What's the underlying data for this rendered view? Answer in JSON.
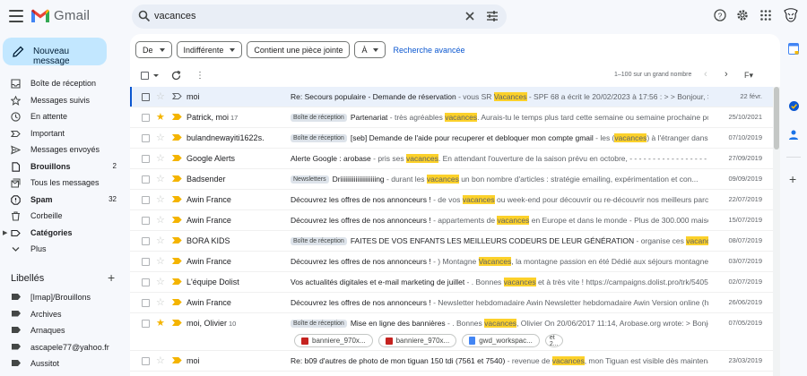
{
  "app": {
    "name": "Gmail",
    "colors": {
      "accent": "#0b57d0",
      "compose": "#c2e7ff",
      "highlight": "#fcd12a",
      "star": "#f4b400",
      "important": "#f4b400"
    }
  },
  "search": {
    "query": "vacances",
    "icons": [
      "search-icon",
      "clear-icon",
      "filter-options-icon"
    ]
  },
  "header_icons": [
    "help-icon",
    "gear-icon",
    "apps-grid-icon",
    "account-avatar"
  ],
  "compose": {
    "label": "Nouveau message"
  },
  "nav": [
    {
      "label": "Boîte de réception",
      "icon": "inbox-icon",
      "count": ""
    },
    {
      "label": "Messages suivis",
      "icon": "star-icon",
      "count": ""
    },
    {
      "label": "En attente",
      "icon": "clock-icon",
      "count": ""
    },
    {
      "label": "Important",
      "icon": "important-icon",
      "count": ""
    },
    {
      "label": "Messages envoyés",
      "icon": "send-icon",
      "count": ""
    },
    {
      "label": "Brouillons",
      "icon": "draft-icon",
      "count": "2",
      "bold": true
    },
    {
      "label": "Tous les messages",
      "icon": "all-mail-icon",
      "count": ""
    },
    {
      "label": "Spam",
      "icon": "spam-icon",
      "count": "32",
      "bold": true
    },
    {
      "label": "Corbeille",
      "icon": "trash-icon",
      "count": ""
    },
    {
      "label": "Catégories",
      "icon": "category-icon",
      "count": "",
      "bold": true
    },
    {
      "label": "Plus",
      "icon": "chevron-down-icon",
      "count": ""
    }
  ],
  "labels": {
    "title": "Libellés",
    "items": [
      "[Imap]/Brouillons",
      "Archives",
      "Arnaques",
      "ascapele77@yahoo.fr",
      "Aussitot"
    ]
  },
  "filters": {
    "from": "De",
    "date": "Indifférente",
    "has_attachment": "Contient une pièce jointe",
    "to": "À",
    "advanced": "Recherche avancée"
  },
  "pager": {
    "text": "1–100 sur un grand nombre"
  },
  "emails": [
    {
      "from": "moi",
      "count": "",
      "badge": "",
      "subject": "Re: Secours populaire - Demande de réservation",
      "snippet_pre": " - vous SR ",
      "highlight": "Vacances",
      "snippet_post": " - SPF 68 a écrit le 20/02/2023 à 17:56 : > > Bonjour, > > Je...",
      "date": "22 févr.",
      "starred": false,
      "important": false,
      "selected": true
    },
    {
      "from": "Patrick, moi",
      "count": "17",
      "badge": "Boîte de réception",
      "subject": "Partenariat",
      "snippet_pre": " - très agréables ",
      "highlight": "vacances",
      "snippet_post": ". Aurais-tu le temps plus tard cette semaine ou semaine prochaine pour...",
      "date": "25/10/2021",
      "starred": true,
      "important": true
    },
    {
      "from": "bulandnewayiti1622s.",
      "count": "",
      "badge": "Boîte de réception",
      "subject": "[seb] Demande de l'aide pour recuperer et debloquer mon compte gmail",
      "snippet_pre": " - les (",
      "highlight": "vacances",
      "snippet_post": ") à l'étranger dans ...",
      "date": "07/10/2019",
      "starred": false,
      "important": true
    },
    {
      "from": "Google Alerts",
      "count": "",
      "badge": "",
      "subject": "Alerte Google : arobase",
      "snippet_pre": " - pris ses ",
      "highlight": "vacances",
      "snippet_post": ". En attendant l'ouverture de la saison prévu en octobre, - - - - - - - - - - - - - - - - - -",
      "date": "27/09/2019",
      "starred": false,
      "important": true
    },
    {
      "from": "Badsender",
      "count": "",
      "badge": "Newsletters",
      "subject": "Driiiiiiiiiiiiiiiiiiiiing",
      "snippet_pre": " - durant les ",
      "highlight": "vacances",
      "snippet_post": " un bon nombre d'articles : stratégie emailing, expérimentation et con...",
      "date": "09/09/2019",
      "starred": false,
      "important": true
    },
    {
      "from": "Awin France",
      "count": "",
      "badge": "",
      "subject": "Découvrez les offres de nos annonceurs !",
      "snippet_pre": " - de vos ",
      "highlight": "vacances",
      "snippet_post": " ou week-end pour découvrir ou re-découvrir nos meilleurs parc...",
      "date": "22/07/2019",
      "starred": false,
      "important": true
    },
    {
      "from": "Awin France",
      "count": "",
      "badge": "",
      "subject": "Découvrez les offres de nos annonceurs !",
      "snippet_pre": " - appartements de ",
      "highlight": "vacances",
      "snippet_post": " en Europe et dans le monde - Plus de 300.000 maiso...",
      "date": "15/07/2019",
      "starred": false,
      "important": true
    },
    {
      "from": "BORA KIDS",
      "count": "",
      "badge": "Boîte de réception",
      "subject": "FAITES DE VOS ENFANTS LES MEILLEURS CODEURS DE LEUR GÉNÉRATION",
      "snippet_pre": " - organise ces ",
      "highlight": "vacances",
      "snippet_post": " des s...",
      "date": "08/07/2019",
      "starred": false,
      "important": true
    },
    {
      "from": "Awin France",
      "count": "",
      "badge": "",
      "subject": "Découvrez les offres de nos annonceurs !",
      "snippet_pre": " - ) Montagne ",
      "highlight": "Vacances",
      "snippet_post": ", la montagne passion en été Dédié aux séjours montagne e...",
      "date": "03/07/2019",
      "starred": false,
      "important": true
    },
    {
      "from": "L'équipe Dolist",
      "count": "",
      "badge": "",
      "subject": "Vos actualités digitales et e-mail marketing de juillet",
      "snippet_pre": " - . Bonnes ",
      "highlight": "vacances",
      "snippet_post": " et à très vite ! https://campaigns.dolist.pro/trk/5405...",
      "date": "02/07/2019",
      "starred": false,
      "important": true
    },
    {
      "from": "Awin France",
      "count": "",
      "badge": "",
      "subject": "Découvrez les offres de nos annonceurs !",
      "snippet_pre": " - Newsletter hebdomadaire Awin Newsletter hebdomadaire Awin Version online (htt...",
      "highlight": "",
      "snippet_post": "",
      "date": "26/06/2019",
      "starred": false,
      "important": true
    },
    {
      "from": "moi, Olivier",
      "count": "10",
      "badge": "Boîte de réception",
      "subject": "Mise en ligne des bannières",
      "snippet_pre": " - . Bonnes ",
      "highlight": "vacances",
      "snippet_post": ", Olivier On 20/06/2017 11:14, Arobase.org wrote: > Bonjour...",
      "date": "07/05/2019",
      "starred": true,
      "important": true,
      "attachments": [
        {
          "name": "banniere_970x...",
          "type": "image"
        },
        {
          "name": "banniere_970x...",
          "type": "image"
        },
        {
          "name": "gwd_workspac...",
          "type": "doc"
        }
      ],
      "more": "et 2..."
    },
    {
      "from": "moi",
      "count": "",
      "badge": "",
      "subject": "Re: b09 d'autres de photo de mon tiguan 150 tdi (7561 et 7540)",
      "snippet_pre": " - revenue de ",
      "highlight": "vacances",
      "snippet_post": ", mon Tiguan est visible dès maintenan...",
      "date": "23/03/2019",
      "starred": false,
      "important": true
    }
  ]
}
